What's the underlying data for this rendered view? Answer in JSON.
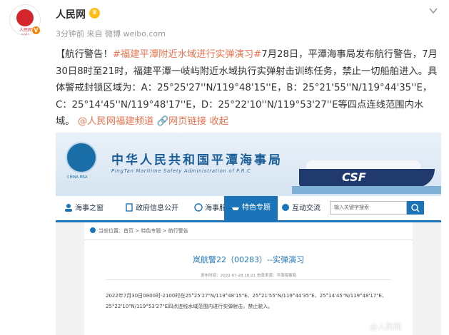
{
  "post": {
    "author": "人民网",
    "avatar_text": "人民网 people.cn",
    "meta": "3分钟前  来自 微博 weibo.com",
    "text_intro": "【航行警告！",
    "hashtag": "#福建平潭附近水域进行实弹演习#",
    "text_body": "7月28日，平潭海事局发布航行警告，7月30日8时至21时，福建平潭一岐屿附近水域执行实弹射击训练任务，禁止一切船舶进入。具体警戒封锁区域为：A：25°25'27''N/119°48'15''E，B：25°21'55''N/119°44'35''E，C：25°14'45''N/119°48'17''E，D：25°22'10''N/119°53'27''E等四点连线范围内水域。",
    "mention": "@人民网福建频道",
    "web_link": "网页链接",
    "collapse": "收起"
  },
  "screenshot": {
    "site_title_cn": "中华人民共和国平潭海事局",
    "site_title_en": "PingTan Maritime Safety Administration of P.R.C",
    "emblem_text": "CHINA MSA",
    "ship_label": "CSF",
    "nav": [
      {
        "label": "海事之窗",
        "icon": "people-icon"
      },
      {
        "label": "政府信息公开",
        "icon": "document-icon"
      },
      {
        "label": "海事服务",
        "icon": "service-icon"
      },
      {
        "label": "特色专题",
        "icon": "ship-icon"
      },
      {
        "label": "互动交流",
        "icon": "chat-icon"
      }
    ],
    "search_placeholder": "输入关键字搜索",
    "breadcrumb": "当前位置：首页 > 特色专题 > 航行警告",
    "article_title": "岚航警22（00283）--实弹演习",
    "article_meta": "发布时间：2022-07-28 16:21  信息来源：平潭海事局",
    "article_body": "2022年7月30日0800时-2100时在25°25'27\"N/119°48'15\"E、25°21'55\"N/119°44'35\"E、25°14'45\"N/119°48'17\"E、25°22'10\"N/119°53'27\"E四点连线水域范围内进行实弹射击，禁止驶入。",
    "watermark": "@人民网"
  },
  "colors": {
    "link": "#eb7350",
    "nav_blue": "#1b74b8",
    "brand_red": "#d3252b"
  }
}
